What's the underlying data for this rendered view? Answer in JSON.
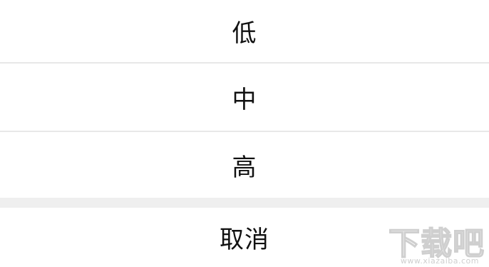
{
  "options": [
    {
      "label": "低"
    },
    {
      "label": "中"
    },
    {
      "label": "高"
    }
  ],
  "cancel_label": "取消",
  "watermark": {
    "text": "下载吧",
    "sub": "www.xiazaiba.com"
  },
  "colors": {
    "background": "#ffffff",
    "text": "#111111",
    "divider": "#e8e8e8",
    "section_gap": "#efefef"
  }
}
